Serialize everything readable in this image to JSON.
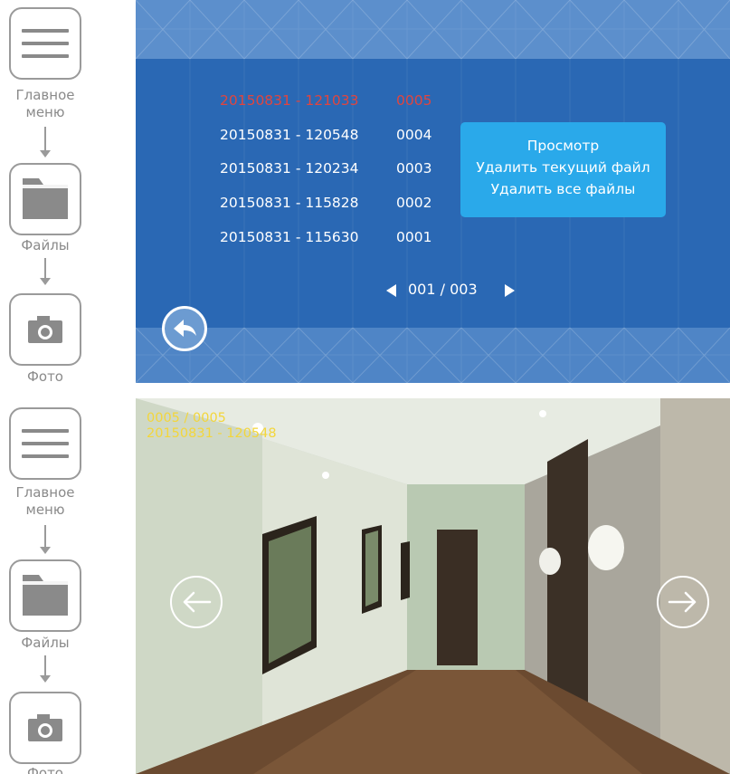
{
  "nav_top": {
    "main_menu_label": "Главное\nменю",
    "files_label": "Файлы",
    "photo_label": "Фото"
  },
  "nav_bottom": {
    "main_menu_label": "Главное\nменю",
    "files_label": "Файлы",
    "photo_label": "Фото"
  },
  "file_list": [
    {
      "name": "20150831 - 121033",
      "num": "0005",
      "selected": true
    },
    {
      "name": "20150831 - 120548",
      "num": "0004",
      "selected": false
    },
    {
      "name": "20150831 - 120234",
      "num": "0003",
      "selected": false
    },
    {
      "name": "20150831 - 115828",
      "num": "0002",
      "selected": false
    },
    {
      "name": "20150831 - 115630",
      "num": "0001",
      "selected": false
    }
  ],
  "popup_menu": {
    "items": [
      "Просмотр",
      "Удалить текущий файл",
      "Удалить все файлы"
    ]
  },
  "pager": {
    "text": "001 / 003"
  },
  "photo_view": {
    "counter": "0005 / 0005",
    "filename": "20150831 - 120548"
  },
  "colors": {
    "screen_blue": "#2a68b4",
    "popup_blue": "#2aa9ea",
    "selected_red": "#e0453f",
    "overlay_yellow": "#f3d63b"
  }
}
